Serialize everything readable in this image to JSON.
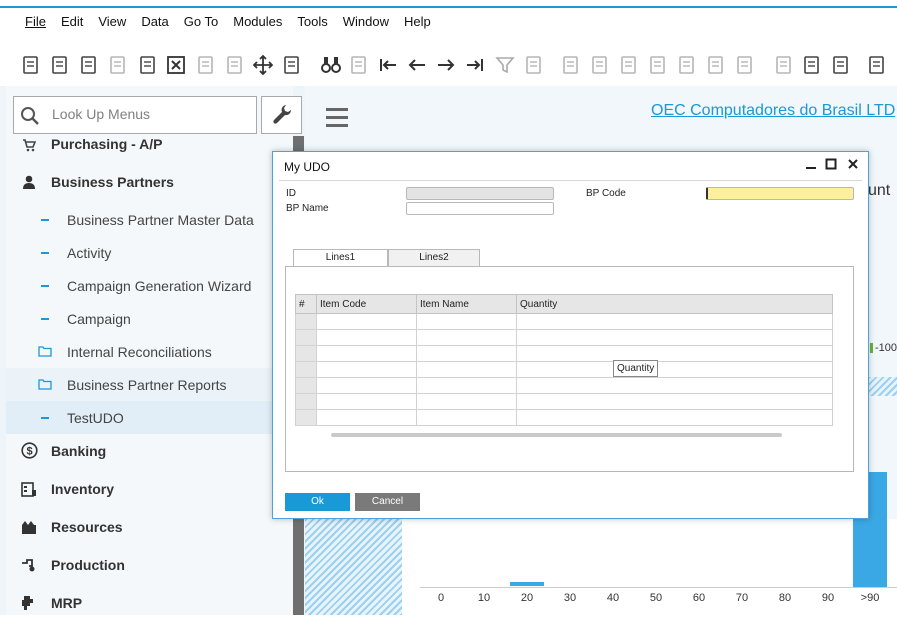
{
  "menubar": [
    "File",
    "Edit",
    "View",
    "Data",
    "Go To",
    "Modules",
    "Tools",
    "Window",
    "Help"
  ],
  "toolbar_icons": [
    "search-doc-icon",
    "print-preview-icon",
    "email-icon",
    "sms-icon",
    "fax-icon",
    "excel-icon",
    "word-icon",
    "pdf-icon",
    "move-icon",
    "form-settings-icon",
    "binoculars-icon",
    "add-doc-icon",
    "first-record-icon",
    "previous-record-icon",
    "next-record-icon",
    "last-record-icon",
    "filter-icon",
    "sort-icon",
    "base-doc-icon",
    "target-doc-icon",
    "payment-icon",
    "payment-means-icon",
    "balance-icon",
    "journal-icon",
    "gross-profit-icon",
    "edit-icon",
    "settings-doc-icon",
    "config-icon",
    "approve-icon"
  ],
  "sidebar": {
    "search_placeholder": "Look Up Menus",
    "modules": [
      {
        "label": "Purchasing - A/P",
        "icon": "cart-icon"
      },
      {
        "label": "Business Partners",
        "icon": "person-icon"
      },
      {
        "label": "Banking",
        "icon": "dollar-icon"
      },
      {
        "label": "Inventory",
        "icon": "inventory-icon"
      },
      {
        "label": "Resources",
        "icon": "resources-icon"
      },
      {
        "label": "Production",
        "icon": "production-icon"
      },
      {
        "label": "MRP",
        "icon": "mrp-icon"
      }
    ],
    "bp_items": [
      {
        "label": "Business Partner Master Data",
        "type": "item"
      },
      {
        "label": "Activity",
        "type": "item"
      },
      {
        "label": "Campaign Generation Wizard",
        "type": "item"
      },
      {
        "label": "Campaign",
        "type": "item"
      },
      {
        "label": "Internal Reconciliations",
        "type": "folder"
      },
      {
        "label": "Business Partner Reports",
        "type": "folder"
      },
      {
        "label": "TestUDO",
        "type": "item"
      }
    ]
  },
  "content": {
    "company": "OEC Computadores do Brasil LTD",
    "partial_title": "unt",
    "legend_partial": "-100",
    "axis_ticks": [
      "0",
      "10",
      "20",
      "30",
      "40",
      "50",
      "60",
      "70",
      "80",
      "90",
      ">90"
    ]
  },
  "dialog": {
    "title": "My UDO",
    "fields": {
      "id_label": "ID",
      "id_value": "",
      "bp_name_label": "BP Name",
      "bp_name_value": "",
      "bp_code_label": "BP Code",
      "bp_code_value": ""
    },
    "tabs": [
      "Lines1",
      "Lines2"
    ],
    "grid": {
      "columns": [
        "#",
        "Item Code",
        "Item Name",
        "Quantity"
      ],
      "row_count": 7
    },
    "tooltip": "Quantity",
    "ok_label": "Ok",
    "cancel_label": "Cancel",
    "colors": {
      "ok": "#1a98d8",
      "cancel": "#7a7a7a",
      "bp_code_bg": "#fdf09a"
    }
  }
}
